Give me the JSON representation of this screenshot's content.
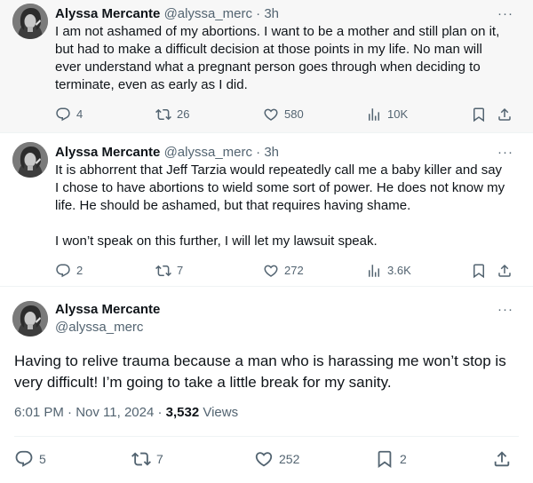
{
  "tweets": [
    {
      "name": "Alyssa Mercante",
      "handle": "@alyssa_merc",
      "dot": "·",
      "time": "3h",
      "more": "···",
      "text": "I am not ashamed of my abortions. I want to be a mother and still plan on it, but had to make a difficult decision at those points in my life. No man will ever understand what a pregnant person goes through when deciding to terminate, even as early as I did.",
      "replies": "4",
      "reposts": "26",
      "likes": "580",
      "views": "10K"
    },
    {
      "name": "Alyssa Mercante",
      "handle": "@alyssa_merc",
      "dot": "·",
      "time": "3h",
      "more": "···",
      "text": "It is abhorrent that Jeff Tarzia would repeatedly call me a baby killer and say I chose to have abortions to wield some sort of power. He does not know my life. He should be ashamed, but that requires having shame.\n\nI won’t speak on this further, I will let my lawsuit speak.",
      "replies": "2",
      "reposts": "7",
      "likes": "272",
      "views": "3.6K"
    }
  ],
  "main": {
    "name": "Alyssa Mercante",
    "handle": "@alyssa_merc",
    "more": "···",
    "text": "Having to relive trauma because a man who is harassing me won’t stop is very difficult! I’m going to take a little break for my sanity.",
    "timestamp": "6:01 PM · Nov 11, 2024 · ",
    "views_count": "3,532",
    "views_label": " Views",
    "replies": "5",
    "reposts": "7",
    "likes": "252",
    "bookmarks": "2"
  },
  "icons": [
    "reply-icon",
    "repost-icon",
    "like-icon",
    "views-icon",
    "bookmark-icon",
    "share-icon",
    "more-icon"
  ],
  "colors": {
    "text": "#0f1419",
    "secondary": "#536471",
    "thread_bg": "#f7f7f7",
    "border": "#eff3f4"
  }
}
